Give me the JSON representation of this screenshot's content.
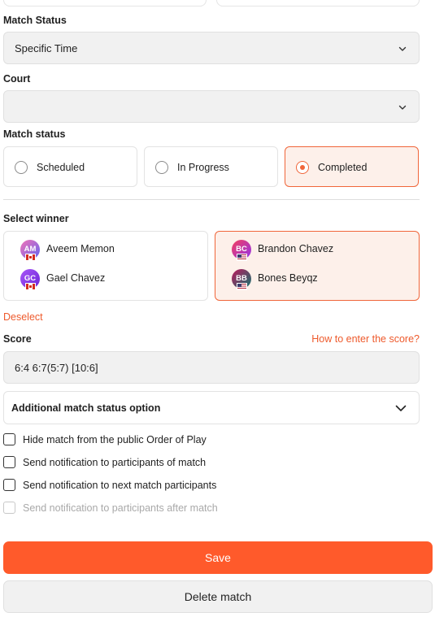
{
  "match_status_section": {
    "label": "Match Status",
    "selected": "Specific Time"
  },
  "court_section": {
    "label": "Court",
    "selected": ""
  },
  "match_status_radio": {
    "label": "Match status",
    "options": [
      {
        "label": "Scheduled",
        "selected": false
      },
      {
        "label": "In Progress",
        "selected": false
      },
      {
        "label": "Completed",
        "selected": true
      }
    ]
  },
  "winner_section": {
    "label": "Select winner",
    "teams": [
      {
        "selected": false,
        "players": [
          {
            "initials": "AM",
            "name": "Aveem Memon",
            "flag": "canada-flag",
            "avatar_color": "#8b5cf6"
          },
          {
            "initials": "GC",
            "name": "Gael Chavez",
            "flag": "canada-flag",
            "avatar_color": "#7c3aed"
          }
        ]
      },
      {
        "selected": true,
        "players": [
          {
            "initials": "BC",
            "name": "Brandon Chavez",
            "flag": "usa-flag",
            "avatar_color": "#e11d48"
          },
          {
            "initials": "BB",
            "name": "Bones Beyqz",
            "flag": "usa-flag",
            "avatar_color": "#0f766e"
          }
        ]
      }
    ],
    "deselect_label": "Deselect"
  },
  "score_section": {
    "label": "Score",
    "help_link": "How to enter the score?",
    "value": "6:4 6:7(5:7) [10:6]"
  },
  "additional_option": {
    "title": "Additional match status option",
    "icon": "chevron-down-icon"
  },
  "checkboxes": [
    {
      "label": "Hide match from the public Order of Play",
      "checked": false,
      "disabled": false
    },
    {
      "label": "Send notification to participants of match",
      "checked": false,
      "disabled": false
    },
    {
      "label": "Send notification to next match participants",
      "checked": false,
      "disabled": false
    },
    {
      "label": "Send notification to participants after match",
      "checked": false,
      "disabled": true
    }
  ],
  "actions": {
    "save_label": "Save",
    "delete_label": "Delete match"
  },
  "colors": {
    "accent": "#ff5a2b",
    "accent_light_bg": "#fdf0ea",
    "field_bg": "#f1f1f1"
  }
}
